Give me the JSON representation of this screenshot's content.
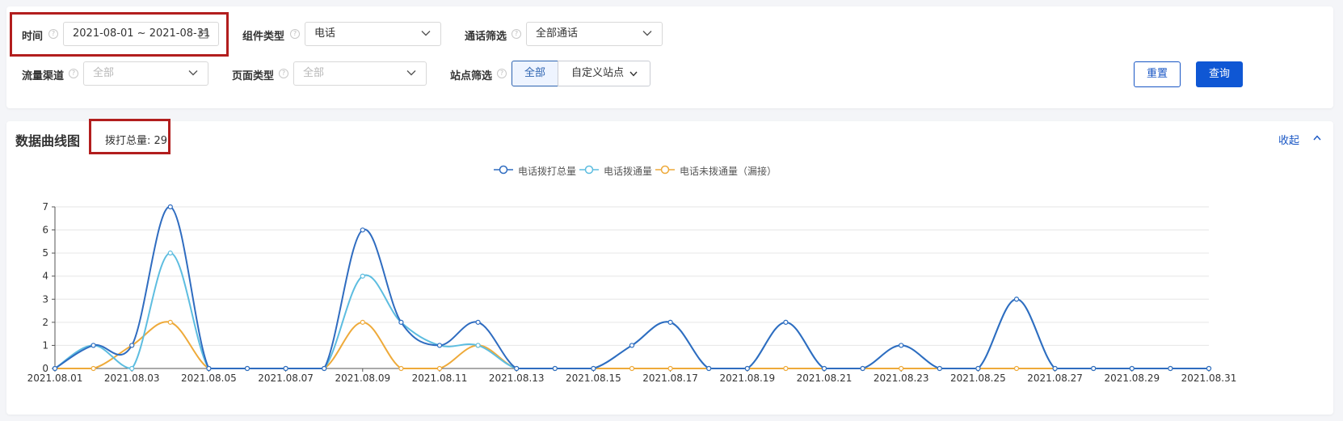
{
  "filters": {
    "time": {
      "label": "时间",
      "value": "2021-08-01 ~ 2021-08-31"
    },
    "component_type": {
      "label": "组件类型",
      "value": "电话"
    },
    "call_filter": {
      "label": "通话筛选",
      "value": "全部通话"
    },
    "traffic_channel": {
      "label": "流量渠道",
      "placeholder": "全部"
    },
    "page_type": {
      "label": "页面类型",
      "placeholder": "全部"
    },
    "site_filter": {
      "label": "站点筛选",
      "all_label": "全部",
      "custom_label": "自定义站点"
    },
    "reset_label": "重置",
    "query_label": "查询",
    "help_glyph": "?"
  },
  "chart_panel": {
    "title": "数据曲线图",
    "total_label": "拨打总量: 29",
    "collapse_label": "收起"
  },
  "colors": {
    "total": "#2f6cc0",
    "connected": "#5dbde0",
    "missed": "#eeaa3a",
    "highlight": "#b21e1e",
    "accent": "#1856c4"
  },
  "chart_data": {
    "type": "line",
    "x": [
      "2021.08.01",
      "2021.08.02",
      "2021.08.03",
      "2021.08.04",
      "2021.08.05",
      "2021.08.06",
      "2021.08.07",
      "2021.08.08",
      "2021.08.09",
      "2021.08.10",
      "2021.08.11",
      "2021.08.12",
      "2021.08.13",
      "2021.08.14",
      "2021.08.15",
      "2021.08.16",
      "2021.08.17",
      "2021.08.18",
      "2021.08.19",
      "2021.08.20",
      "2021.08.21",
      "2021.08.22",
      "2021.08.23",
      "2021.08.24",
      "2021.08.25",
      "2021.08.26",
      "2021.08.27",
      "2021.08.28",
      "2021.08.29",
      "2021.08.30",
      "2021.08.31"
    ],
    "x_tick_labels": [
      "2021.08.01",
      "2021.08.03",
      "2021.08.05",
      "2021.08.07",
      "2021.08.09",
      "2021.08.11",
      "2021.08.13",
      "2021.08.15",
      "2021.08.17",
      "2021.08.19",
      "2021.08.21",
      "2021.08.23",
      "2021.08.25",
      "2021.08.27",
      "2021.08.29",
      "2021.08.31"
    ],
    "y_ticks": [
      "0",
      "1",
      "2",
      "3",
      "4",
      "5",
      "6",
      "7"
    ],
    "ylim": [
      0,
      7
    ],
    "grid": true,
    "legend_position": "top-center",
    "series": [
      {
        "name": "电话拨打总量",
        "values": [
          0,
          1,
          1,
          7,
          0,
          0,
          0,
          0,
          6,
          2,
          1,
          2,
          0,
          0,
          0,
          1,
          2,
          0,
          0,
          2,
          0,
          0,
          1,
          0,
          0,
          3,
          0,
          0,
          0,
          0,
          0
        ]
      },
      {
        "name": "电话拨通量",
        "values": [
          0,
          1,
          0,
          5,
          0,
          0,
          0,
          0,
          4,
          2,
          1,
          1,
          0,
          0,
          0,
          1,
          2,
          0,
          0,
          2,
          0,
          0,
          1,
          0,
          0,
          3,
          0,
          0,
          0,
          0,
          0
        ]
      },
      {
        "name": "电话未拨通量（漏接）",
        "values": [
          0,
          0,
          1,
          2,
          0,
          0,
          0,
          0,
          2,
          0,
          0,
          1,
          0,
          0,
          0,
          0,
          0,
          0,
          0,
          0,
          0,
          0,
          0,
          0,
          0,
          0,
          0,
          0,
          0,
          0,
          0
        ]
      }
    ]
  }
}
